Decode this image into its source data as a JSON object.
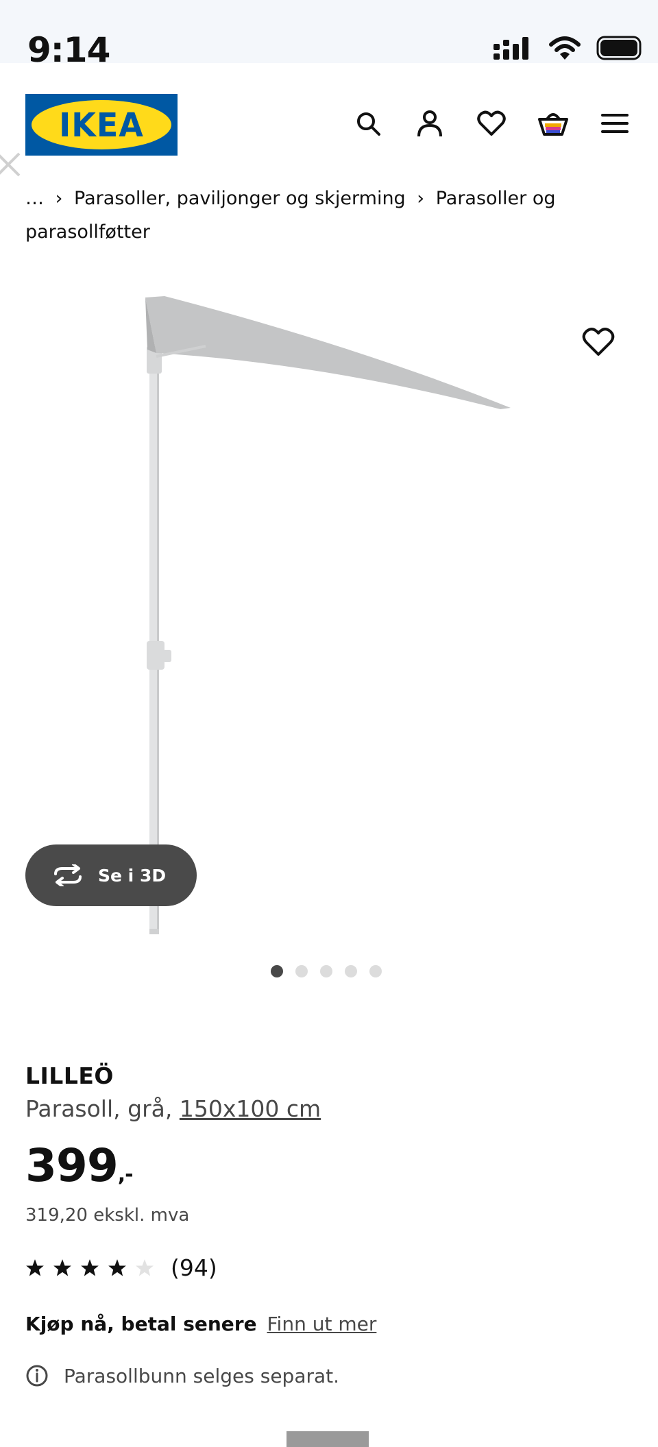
{
  "status_bar": {
    "time": "9:14"
  },
  "header": {
    "logo_text": "IKEA",
    "nav": [
      "search-icon",
      "account-icon",
      "wishlist-icon",
      "cart-icon",
      "menu-icon"
    ]
  },
  "breadcrumb": {
    "ellipsis": "…",
    "items": [
      "Parasoller, paviljonger og skjerming",
      "Parasoller og parasollføtter"
    ]
  },
  "product": {
    "view_3d_label": "Se i 3D",
    "gallery_count": 5,
    "gallery_active": 1,
    "name": "LILLEÖ",
    "desc": "Parasoll, grå,",
    "size": "150x100 cm",
    "price": "399",
    "price_suffix": ",-",
    "price_ex_vat": "319,20 ekskl. mva",
    "rating": 4,
    "rating_max": 5,
    "review_count": "(94)",
    "bnpl_title": "Kjøp nå, betal senere",
    "bnpl_link": "Finn ut mer",
    "info_text": "Parasollbunn selges separat."
  },
  "colors": {
    "brand_blue": "#0058a3",
    "brand_yellow": "#ffda1a"
  }
}
